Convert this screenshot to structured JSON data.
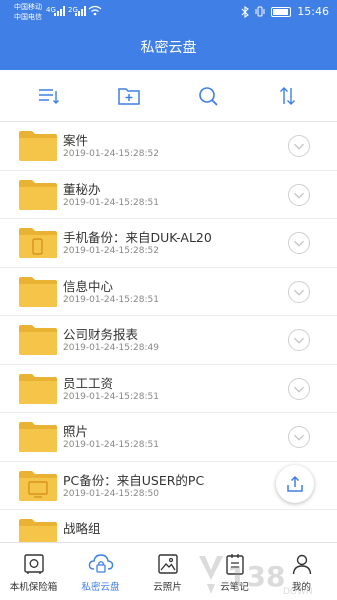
{
  "status": {
    "carrier1": "中国移动",
    "carrier2": "中国电信",
    "net1": "4G",
    "net2": "2G",
    "time": "15:46"
  },
  "header": {
    "title": "私密云盘"
  },
  "toolbar": {
    "icons": [
      "list-view-icon",
      "new-folder-icon",
      "search-icon",
      "sort-icon"
    ]
  },
  "files": [
    {
      "name": "案件",
      "date": "2019-01-24-15:28:52",
      "badge": ""
    },
    {
      "name": "董秘办",
      "date": "2019-01-24-15:28:51",
      "badge": ""
    },
    {
      "name": "手机备份：来自DUK-AL20",
      "date": "2019-01-24-15:28:52",
      "badge": "phone"
    },
    {
      "name": "信息中心",
      "date": "2019-01-24-15:28:51",
      "badge": ""
    },
    {
      "name": "公司财务报表",
      "date": "2019-01-24-15:28:49",
      "badge": ""
    },
    {
      "name": "员工工资",
      "date": "2019-01-24-15:28:51",
      "badge": ""
    },
    {
      "name": "照片",
      "date": "2019-01-24-15:28:51",
      "badge": ""
    },
    {
      "name": "PC备份：来自USER的PC",
      "date": "2019-01-24-15:28:50",
      "badge": "pc"
    },
    {
      "name": "战略组",
      "date": "",
      "badge": ""
    }
  ],
  "nav": [
    {
      "label": "本机保险箱",
      "icon": "safe-icon"
    },
    {
      "label": "私密云盘",
      "icon": "cloud-lock-icon"
    },
    {
      "label": "云照片",
      "icon": "photo-icon"
    },
    {
      "label": "云笔记",
      "icon": "note-icon"
    },
    {
      "label": "我的",
      "icon": "user-icon"
    }
  ],
  "watermark": {
    "text": "138DOWN"
  },
  "colors": {
    "accent": "#3f7fe6",
    "folder": "#f5c54a",
    "folder_dark": "#e9b232"
  }
}
